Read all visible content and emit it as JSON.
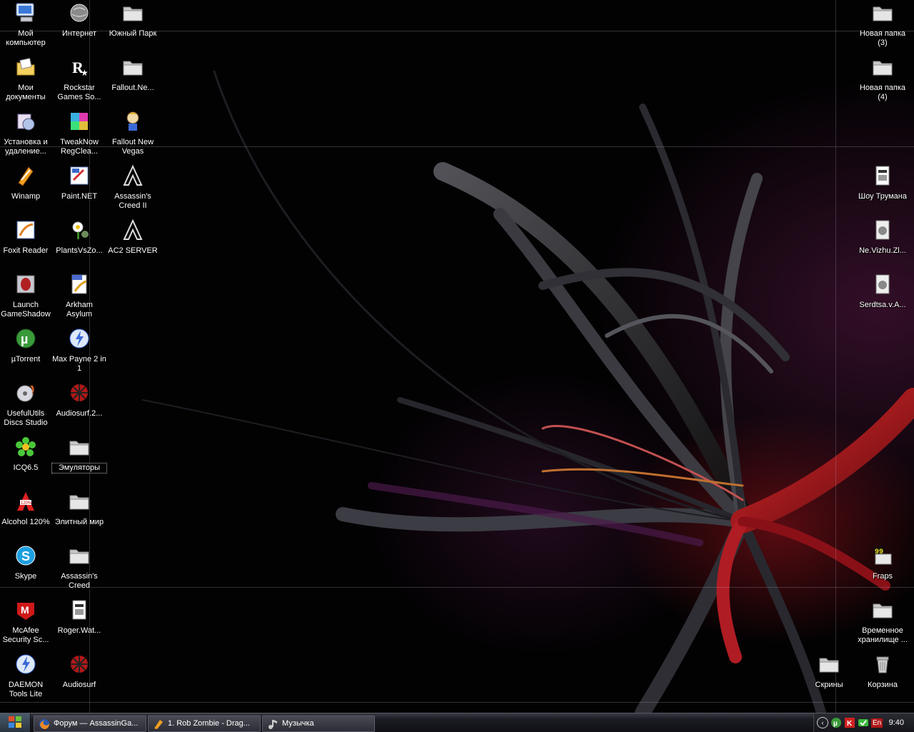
{
  "desktop": {
    "icons": [
      {
        "label": "Мой компьютер",
        "icon": "my-computer-icon"
      },
      {
        "label": "Интернет",
        "icon": "internet-icon"
      },
      {
        "label": "Южный Парк",
        "icon": "folder-icon"
      },
      {
        "label": "Новая папка (3)",
        "icon": "folder-icon"
      },
      {
        "label": "Мои документы",
        "icon": "my-documents-icon"
      },
      {
        "label": "Rockstar Games So...",
        "icon": "rockstar-icon"
      },
      {
        "label": "Fallout.Ne...",
        "icon": "folder-icon"
      },
      {
        "label": "Новая папка (4)",
        "icon": "folder-icon"
      },
      {
        "label": "Установка и удаление...",
        "icon": "add-remove-programs-icon"
      },
      {
        "label": "TweakNow RegClea...",
        "icon": "tweaknow-icon"
      },
      {
        "label": "Fallout New Vegas",
        "icon": "fallout-vault-boy-icon"
      },
      {
        "label": "Winamp",
        "icon": "winamp-icon"
      },
      {
        "label": "Paint.NET",
        "icon": "paint-net-icon"
      },
      {
        "label": "Assassin's Creed II",
        "icon": "assassins-creed-icon"
      },
      {
        "label": "Шоу Трумана",
        "icon": "video-file-icon"
      },
      {
        "label": "Foxit Reader",
        "icon": "foxit-reader-icon"
      },
      {
        "label": "PlantsVsZo...",
        "icon": "plants-vs-zombies-icon"
      },
      {
        "label": "AC2 SERVER",
        "icon": "assassins-creed-icon"
      },
      {
        "label": "Ne.Vizhu.Zl...",
        "icon": "media-file-icon"
      },
      {
        "label": "Launch GameShadow",
        "icon": "gameshadow-icon"
      },
      {
        "label": "Arkham Asylum",
        "icon": "pdf-shortcut-icon"
      },
      {
        "label": "Serdtsa.v.A...",
        "icon": "media-file-icon"
      },
      {
        "label": "µTorrent",
        "icon": "utorrent-icon"
      },
      {
        "label": "Max Payne 2 in 1",
        "icon": "daemon-tools-icon"
      },
      {
        "label": "UsefulUtils Discs Studio",
        "icon": "disc-studio-icon"
      },
      {
        "label": "Audiosurf.2...",
        "icon": "audiosurf-icon"
      },
      {
        "label": "ICQ6.5",
        "icon": "icq-icon"
      },
      {
        "label": "Эмуляторы",
        "icon": "folder-icon"
      },
      {
        "label": "Alcohol 120%",
        "icon": "alcohol-icon"
      },
      {
        "label": "Элитный мир",
        "icon": "folder-icon"
      },
      {
        "label": "Skype",
        "icon": "skype-icon"
      },
      {
        "label": "Assassin's Creed",
        "icon": "folder-icon"
      },
      {
        "label": "Fraps",
        "icon": "fraps-icon"
      },
      {
        "label": "McAfee Security Sc...",
        "icon": "mcafee-icon"
      },
      {
        "label": "Roger.Wat...",
        "icon": "video-file-icon"
      },
      {
        "label": "Временное хранилище ...",
        "icon": "folder-icon"
      },
      {
        "label": "DAEMON Tools Lite",
        "icon": "daemon-tools-icon"
      },
      {
        "label": "Audiosurf",
        "icon": "audiosurf-icon"
      },
      {
        "label": "Скрины",
        "icon": "folder-icon"
      },
      {
        "label": "Корзина",
        "icon": "recycle-bin-icon"
      }
    ]
  },
  "taskbar": {
    "start_icon": "windows-logo-icon",
    "tasks": [
      {
        "label": "Форум — AssassinGa...",
        "icon": "firefox-icon"
      },
      {
        "label": "1. Rob Zombie - Drag...",
        "icon": "winamp-icon"
      },
      {
        "label": "Музычка",
        "icon": "music-folder-icon"
      }
    ],
    "tray": {
      "language": "En",
      "clock": "9:40",
      "icons": [
        "show-hidden-icons-chevron",
        "utorrent-tray-icon",
        "kaspersky-tray-icon",
        "network-tray-icon"
      ]
    }
  },
  "colors": {
    "accent": "#b01818",
    "text": "#ffffff",
    "folder": "#c8c8c8"
  }
}
